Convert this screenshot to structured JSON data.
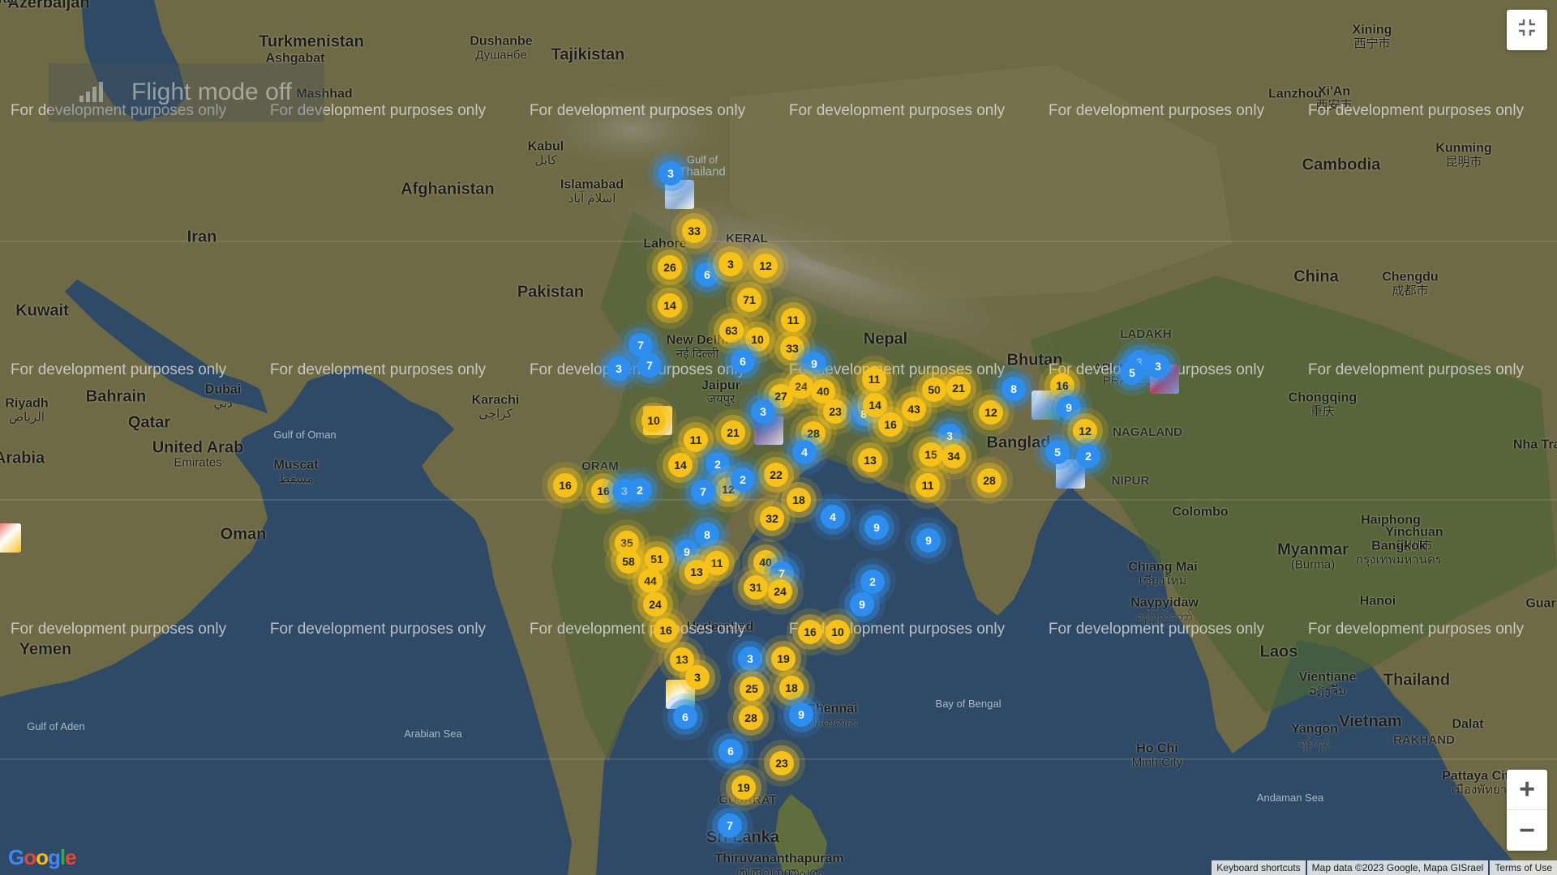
{
  "overlay": {
    "flight_mode": "Flight mode off",
    "watermark": "For development purposes only"
  },
  "controls": {
    "fullscreen_icon": "exit-fullscreen-icon",
    "zoom_in": "+",
    "zoom_out": "−"
  },
  "footer": {
    "logo": "Google",
    "keyboard": "Keyboard shortcuts",
    "map_data": "Map data ©2023 Google, Mapa GISrael",
    "terms": "Terms of Use"
  },
  "colors": {
    "cluster_yellow": "#f6c21a",
    "cluster_blue": "#2d8ef0",
    "ocean": "#2f4a66",
    "land": "#6e6a45"
  },
  "labels": [
    {
      "text": "Azerbaijan",
      "cls": "country"
    },
    {
      "text": "Turkmenistan",
      "cls": "country"
    },
    {
      "text": "Ashgabat",
      "cls": "city"
    },
    {
      "text": "Dushanbe",
      "sub": "Душанбе",
      "cls": "city"
    },
    {
      "text": "Tajikistan",
      "cls": "country"
    },
    {
      "text": "Mashhad",
      "cls": "city"
    },
    {
      "text": "Kabul",
      "sub": "کابل",
      "cls": "city"
    },
    {
      "text": "Afghanistan",
      "cls": "country"
    },
    {
      "text": "Islamabad",
      "sub": "اسلام آباد",
      "cls": "city"
    },
    {
      "text": "Iran",
      "cls": "country"
    },
    {
      "text": "Lahore",
      "cls": "city"
    },
    {
      "text": "Pakistan",
      "cls": "country"
    },
    {
      "text": "Kuwait",
      "cls": "country"
    },
    {
      "text": "Riyadh",
      "sub": "الرياض",
      "cls": "city"
    },
    {
      "text": "Bahrain",
      "cls": "country"
    },
    {
      "text": "Dubai",
      "sub": "دبي",
      "cls": "city"
    },
    {
      "text": "Qatar",
      "cls": "country"
    },
    {
      "text": "United Arab",
      "sub": "Emirates",
      "cls": "country"
    },
    {
      "text": "Muscat",
      "sub": "مسقط",
      "cls": "city"
    },
    {
      "text": "Arabia",
      "cls": "country"
    },
    {
      "text": "Oman",
      "cls": "country"
    },
    {
      "text": "Yemen",
      "cls": "country"
    },
    {
      "text": "Gulf of Aden",
      "cls": "sea"
    },
    {
      "text": "Arabian Sea",
      "cls": "sea"
    },
    {
      "text": "Karachi",
      "sub": "کراچی",
      "cls": "city"
    },
    {
      "text": "Gulf of Oman",
      "cls": "sea"
    },
    {
      "text": "New Delhi",
      "sub": "नई दिल्ली",
      "cls": "city"
    },
    {
      "text": "Jaipur",
      "sub": "जयपुर",
      "cls": "city"
    },
    {
      "text": "Nepal",
      "cls": "country"
    },
    {
      "text": "Bhutan",
      "cls": "country"
    },
    {
      "text": "Banglad",
      "cls": "country"
    },
    {
      "text": "Hyderabad",
      "cls": "city"
    },
    {
      "text": "Chennai",
      "sub": "சென்னை",
      "cls": "city"
    },
    {
      "text": "Bay of Bengal",
      "cls": "sea"
    },
    {
      "text": "Sri Lanka",
      "cls": "country"
    },
    {
      "text": "Thiruvananthapuram",
      "sub": "തിരുവനന്തപുരം",
      "cls": "city"
    },
    {
      "text": "Colombo",
      "cls": "city"
    },
    {
      "text": "Myanmar",
      "sub": "(Burma)",
      "cls": "country"
    },
    {
      "text": "Laos",
      "cls": "country"
    },
    {
      "text": "Thailand",
      "cls": "country"
    },
    {
      "text": "Vietnam",
      "cls": "country"
    },
    {
      "text": "Cambodia",
      "cls": "country"
    },
    {
      "text": "China",
      "cls": "country"
    },
    {
      "text": "Chengdu",
      "sub": "成都市",
      "cls": "city"
    },
    {
      "text": "Chongqing",
      "sub": "重庆",
      "cls": "city"
    },
    {
      "text": "Kunming",
      "sub": "昆明市",
      "cls": "city"
    },
    {
      "text": "Xi'An",
      "sub": "西安市",
      "cls": "city"
    },
    {
      "text": "Lanzhou",
      "cls": "city"
    },
    {
      "text": "Xining",
      "sub": "西宁市",
      "cls": "city"
    },
    {
      "text": "Yinchuan",
      "sub": "银川市",
      "cls": "city"
    },
    {
      "text": "Haiphong",
      "cls": "city"
    },
    {
      "text": "Hanoi",
      "cls": "city"
    },
    {
      "text": "Vientiane",
      "sub": "ວຽງຈັນ",
      "cls": "city"
    },
    {
      "text": "Bangkok",
      "sub": "กรุงเทพมหานคร",
      "cls": "city"
    },
    {
      "text": "Chiang Mai",
      "sub": "เชียงใหม่",
      "cls": "city"
    },
    {
      "text": "Naypyidaw",
      "sub": "နေပြည်တော်",
      "cls": "city"
    },
    {
      "text": "Yangon",
      "sub": "ရန်ကုန်",
      "cls": "city"
    },
    {
      "text": "Pattaya City",
      "sub": "เมืองพัทยา",
      "cls": "city"
    },
    {
      "text": "Ho Chi",
      "sub": "Minh City",
      "cls": "city"
    },
    {
      "text": "Andaman Sea",
      "cls": "sea"
    },
    {
      "text": "Gulf of",
      "sub": "Thailand",
      "cls": "sea"
    },
    {
      "text": "LADAKH",
      "cls": "region"
    },
    {
      "text": "ARUNACHAL",
      "sub": "PRADESH",
      "cls": "region"
    },
    {
      "text": "NAGALAND",
      "cls": "region"
    },
    {
      "text": "NIPUR",
      "cls": "region"
    },
    {
      "text": "ORAM",
      "cls": "region"
    },
    {
      "text": "GUJARAT",
      "cls": "region"
    },
    {
      "text": "KERAL",
      "cls": "region"
    },
    {
      "text": "RAKHAND",
      "cls": "region"
    },
    {
      "text": "Dalat",
      "cls": "city"
    },
    {
      "text": "Nha Trang",
      "cls": "city"
    },
    {
      "text": "Guar",
      "cls": "city"
    },
    {
      "text": "Parac",
      "cls": "city"
    }
  ],
  "clusters": [
    {
      "n": "3",
      "c": "blue"
    },
    {
      "n": "33",
      "c": "yellow"
    },
    {
      "n": "26",
      "c": "yellow"
    },
    {
      "n": "6",
      "c": "blue"
    },
    {
      "n": "3",
      "c": "yellow"
    },
    {
      "n": "12",
      "c": "yellow"
    },
    {
      "n": "14",
      "c": "yellow"
    },
    {
      "n": "71",
      "c": "yellow"
    },
    {
      "n": "11",
      "c": "yellow"
    },
    {
      "n": "63",
      "c": "yellow"
    },
    {
      "n": "10",
      "c": "yellow"
    },
    {
      "n": "33",
      "c": "yellow"
    },
    {
      "n": "7",
      "c": "blue"
    },
    {
      "n": "3",
      "c": "blue"
    },
    {
      "n": "7",
      "c": "blue"
    },
    {
      "n": "6",
      "c": "blue"
    },
    {
      "n": "9",
      "c": "blue"
    },
    {
      "n": "24",
      "c": "yellow"
    },
    {
      "n": "27",
      "c": "yellow"
    },
    {
      "n": "40",
      "c": "yellow"
    },
    {
      "n": "23",
      "c": "yellow"
    },
    {
      "n": "8",
      "c": "blue"
    },
    {
      "n": "11",
      "c": "yellow"
    },
    {
      "n": "50",
      "c": "yellow"
    },
    {
      "n": "21",
      "c": "yellow"
    },
    {
      "n": "43",
      "c": "yellow"
    },
    {
      "n": "3",
      "c": "blue"
    },
    {
      "n": "10",
      "c": "yellow"
    },
    {
      "n": "11",
      "c": "yellow"
    },
    {
      "n": "21",
      "c": "yellow"
    },
    {
      "n": "28",
      "c": "yellow"
    },
    {
      "n": "4",
      "c": "blue"
    },
    {
      "n": "3",
      "c": "blue"
    },
    {
      "n": "16",
      "c": "yellow"
    },
    {
      "n": "12",
      "c": "yellow"
    },
    {
      "n": "8",
      "c": "blue"
    },
    {
      "n": "16",
      "c": "yellow"
    },
    {
      "n": "9",
      "c": "blue"
    },
    {
      "n": "3",
      "c": "blue"
    },
    {
      "n": "12",
      "c": "yellow"
    },
    {
      "n": "5",
      "c": "blue"
    },
    {
      "n": "2",
      "c": "blue"
    },
    {
      "n": "5",
      "c": "blue"
    },
    {
      "n": "3",
      "c": "blue"
    },
    {
      "n": "15",
      "c": "yellow"
    },
    {
      "n": "34",
      "c": "yellow"
    },
    {
      "n": "13",
      "c": "yellow"
    },
    {
      "n": "11",
      "c": "yellow"
    },
    {
      "n": "28",
      "c": "yellow"
    },
    {
      "n": "14",
      "c": "yellow"
    },
    {
      "n": "2",
      "c": "blue"
    },
    {
      "n": "12",
      "c": "yellow"
    },
    {
      "n": "22",
      "c": "yellow"
    },
    {
      "n": "7",
      "c": "blue"
    },
    {
      "n": "2",
      "c": "blue"
    },
    {
      "n": "18",
      "c": "yellow"
    },
    {
      "n": "16",
      "c": "yellow"
    },
    {
      "n": "16",
      "c": "yellow"
    },
    {
      "n": "32",
      "c": "yellow"
    },
    {
      "n": "3",
      "c": "blue"
    },
    {
      "n": "2",
      "c": "blue"
    },
    {
      "n": "4",
      "c": "blue"
    },
    {
      "n": "9",
      "c": "blue"
    },
    {
      "n": "9",
      "c": "blue"
    },
    {
      "n": "8",
      "c": "blue"
    },
    {
      "n": "9",
      "c": "blue"
    },
    {
      "n": "35",
      "c": "yellow"
    },
    {
      "n": "58",
      "c": "yellow"
    },
    {
      "n": "51",
      "c": "yellow"
    },
    {
      "n": "11",
      "c": "yellow"
    },
    {
      "n": "13",
      "c": "yellow"
    },
    {
      "n": "44",
      "c": "yellow"
    },
    {
      "n": "40",
      "c": "yellow"
    },
    {
      "n": "7",
      "c": "blue"
    },
    {
      "n": "31",
      "c": "yellow"
    },
    {
      "n": "24",
      "c": "yellow"
    },
    {
      "n": "24",
      "c": "yellow"
    },
    {
      "n": "2",
      "c": "blue"
    },
    {
      "n": "9",
      "c": "blue"
    },
    {
      "n": "16",
      "c": "yellow"
    },
    {
      "n": "16",
      "c": "yellow"
    },
    {
      "n": "10",
      "c": "yellow"
    },
    {
      "n": "13",
      "c": "yellow"
    },
    {
      "n": "3",
      "c": "blue"
    },
    {
      "n": "19",
      "c": "yellow"
    },
    {
      "n": "25",
      "c": "yellow"
    },
    {
      "n": "18",
      "c": "yellow"
    },
    {
      "n": "6",
      "c": "blue"
    },
    {
      "n": "28",
      "c": "yellow"
    },
    {
      "n": "9",
      "c": "blue"
    },
    {
      "n": "6",
      "c": "blue"
    },
    {
      "n": "23",
      "c": "yellow"
    },
    {
      "n": "19",
      "c": "yellow"
    },
    {
      "n": "7",
      "c": "blue"
    },
    {
      "n": "3",
      "c": "yellow"
    },
    {
      "n": "14",
      "c": "yellow"
    }
  ]
}
